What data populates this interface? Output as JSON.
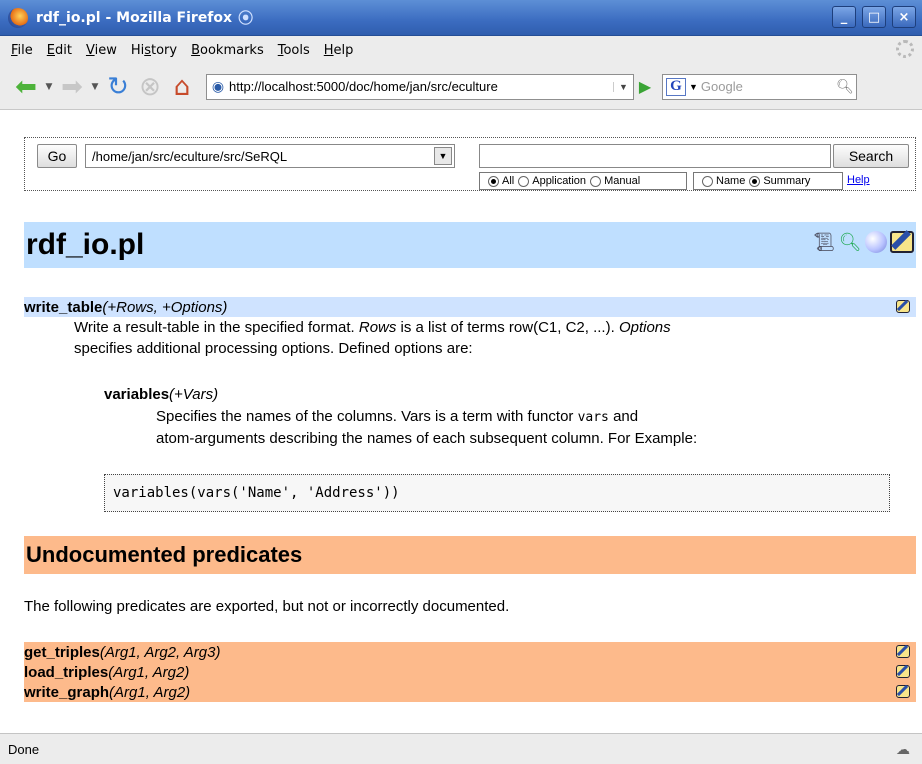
{
  "window": {
    "title": "rdf_io.pl - Mozilla Firefox",
    "controls": [
      "_",
      "□",
      "×"
    ]
  },
  "menu": {
    "items": [
      {
        "label": "File",
        "mnemonic": "F"
      },
      {
        "label": "Edit",
        "mnemonic": "E"
      },
      {
        "label": "View",
        "mnemonic": "V"
      },
      {
        "label": "History",
        "mnemonic": "s"
      },
      {
        "label": "Bookmarks",
        "mnemonic": "B"
      },
      {
        "label": "Tools",
        "mnemonic": "T"
      },
      {
        "label": "Help",
        "mnemonic": "H"
      }
    ]
  },
  "nav": {
    "url": "http://localhost:5000/doc/home/jan/src/eculture",
    "search_placeholder": "Google",
    "search_engine_letter": "G"
  },
  "form": {
    "go_label": "Go",
    "directory": "/home/jan/src/eculture/src/SeRQL",
    "search_label": "Search",
    "query_value": "",
    "scope_options": [
      {
        "label": "All",
        "checked": true
      },
      {
        "label": "Application",
        "checked": false
      },
      {
        "label": "Manual",
        "checked": false
      }
    ],
    "field_options": [
      {
        "label": "Name",
        "checked": false
      },
      {
        "label": "Summary",
        "checked": true
      }
    ],
    "help_label": "Help"
  },
  "doc": {
    "file_title": "rdf_io.pl",
    "predicate": {
      "name": "write_table",
      "args": "(+Rows, +Options)",
      "desc_1a": "Write a result-table in the specified format.",
      "desc_1b": "Rows",
      "desc_1c": "is a list of terms row(C1, C2, ...).",
      "desc_1d": "Options",
      "desc_2": "specifies additional processing options. Defined options are:",
      "option_name": "variables",
      "option_args": "(+Vars)",
      "option_desc_1a": "Specifies the names of the columns. Vars is a term with functor",
      "option_desc_1b": "vars",
      "option_desc_1c": "and",
      "option_desc_2": "atom-arguments describing the names of each subsequent column. For Example:",
      "code": "variables(vars('Name', 'Address'))"
    },
    "undocumented": {
      "heading": "Undocumented predicates",
      "intro": "The following predicates are exported, but not or incorrectly documented.",
      "predicates": [
        {
          "name": "get_triples",
          "args": "(Arg1, Arg2, Arg3)"
        },
        {
          "name": "load_triples",
          "args": "(Arg1, Arg2)"
        },
        {
          "name": "write_graph",
          "args": "(Arg1, Arg2)"
        }
      ]
    }
  },
  "status": {
    "text": "Done"
  }
}
